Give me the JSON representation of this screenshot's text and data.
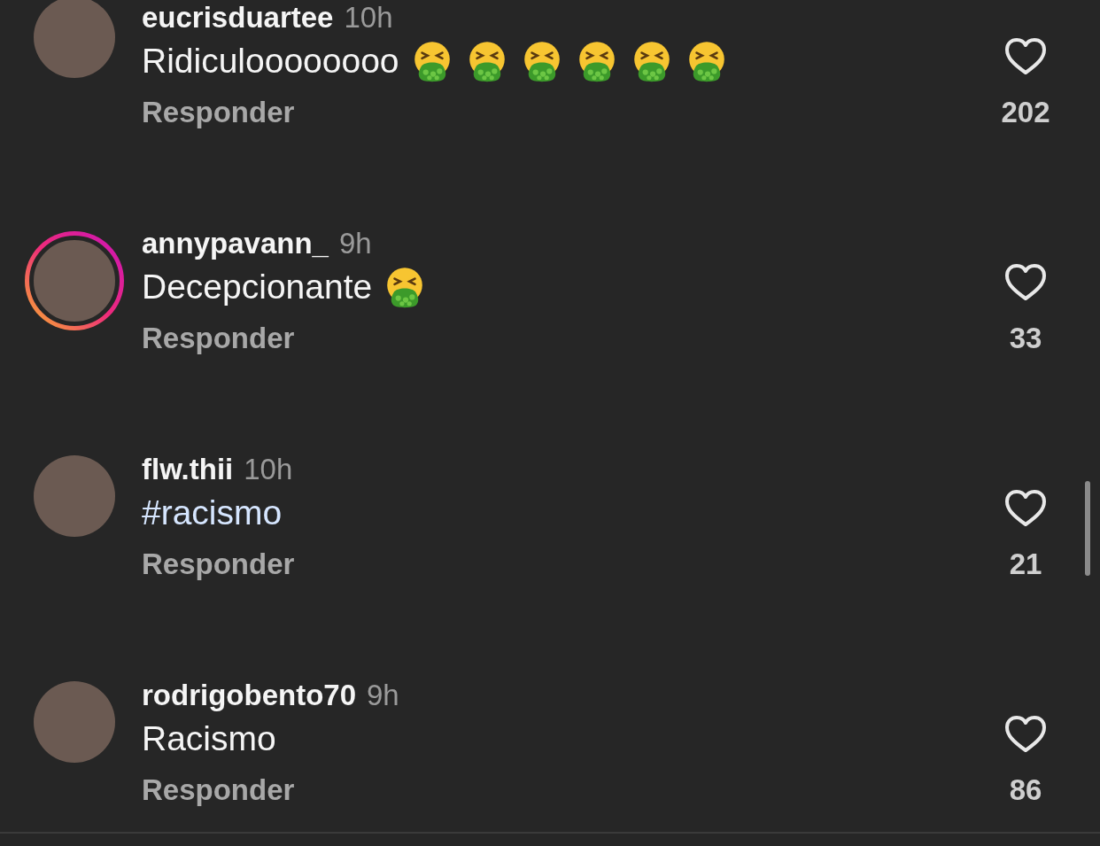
{
  "comments": [
    {
      "username": "eucrisduartee",
      "time": "10h",
      "text": "Ridiculoooooooo",
      "is_hashtag": false,
      "emojis": [
        {
          "kind": "vomiting-face"
        },
        {
          "kind": "vomiting-face"
        },
        {
          "kind": "vomiting-face"
        },
        {
          "kind": "vomiting-face"
        },
        {
          "kind": "vomiting-face"
        },
        {
          "kind": "vomiting-face"
        }
      ],
      "story_ring": false,
      "reply": "Responder",
      "likes": "202",
      "liked": false
    },
    {
      "username": "annypavann_",
      "time": "9h",
      "text": "Decepcionante",
      "is_hashtag": false,
      "emojis": [
        {
          "kind": "vomiting-face"
        }
      ],
      "story_ring": true,
      "reply": "Responder",
      "likes": "33",
      "liked": false
    },
    {
      "username": "flw.thii",
      "time": "10h",
      "text": "#racismo",
      "is_hashtag": true,
      "story_ring": false,
      "reply": "Responder",
      "likes": "21",
      "liked": false
    },
    {
      "username": "rodrigobento70",
      "time": "9h",
      "text": "Racismo",
      "is_hashtag": false,
      "story_ring": false,
      "reply": "Responder",
      "likes": "86",
      "liked": false
    }
  ]
}
